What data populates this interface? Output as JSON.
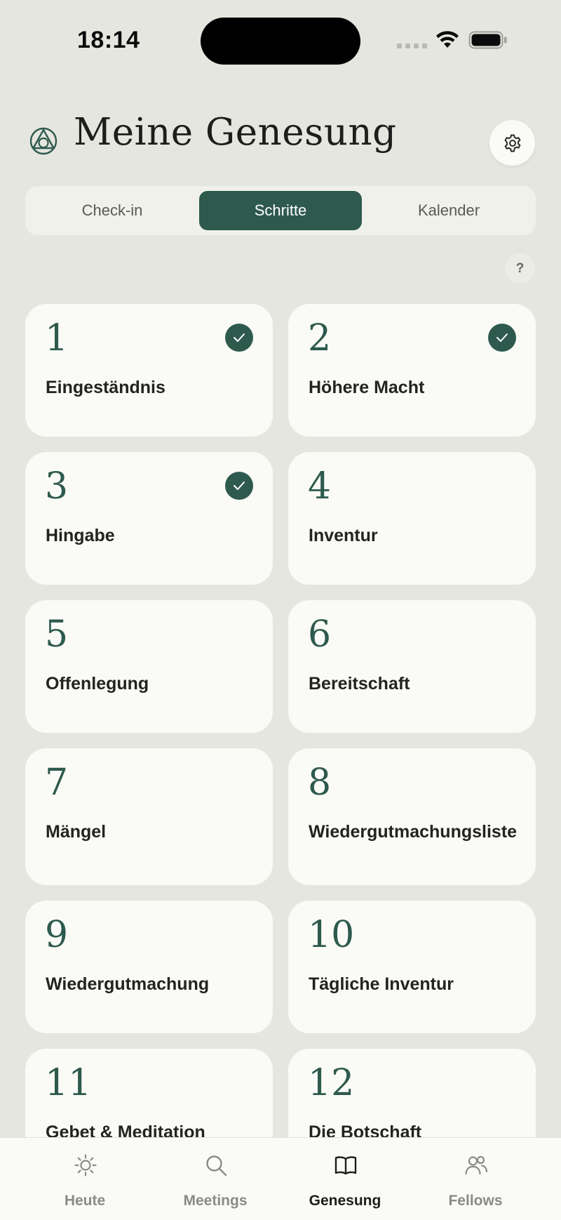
{
  "status_bar": {
    "time": "18:14"
  },
  "header": {
    "title": "Meine Genesung"
  },
  "segments": [
    {
      "label": "Check-in",
      "selected": false
    },
    {
      "label": "Schritte",
      "selected": true
    },
    {
      "label": "Kalender",
      "selected": false
    }
  ],
  "help": {
    "label": "?"
  },
  "steps": [
    {
      "number": "1",
      "label": "Eingeständnis",
      "completed": true
    },
    {
      "number": "2",
      "label": "Höhere Macht",
      "completed": true
    },
    {
      "number": "3",
      "label": "Hingabe",
      "completed": true
    },
    {
      "number": "4",
      "label": "Inventur",
      "completed": false
    },
    {
      "number": "5",
      "label": "Offenlegung",
      "completed": false
    },
    {
      "number": "6",
      "label": "Bereitschaft",
      "completed": false
    },
    {
      "number": "7",
      "label": "Mängel",
      "completed": false
    },
    {
      "number": "8",
      "label": "Wiedergutmachungsliste",
      "completed": false
    },
    {
      "number": "9",
      "label": "Wiedergutmachung",
      "completed": false
    },
    {
      "number": "10",
      "label": "Tägliche Inventur",
      "completed": false
    },
    {
      "number": "11",
      "label": "Gebet & Meditation",
      "completed": false
    },
    {
      "number": "12",
      "label": "Die Botschaft",
      "completed": false
    }
  ],
  "tabbar": {
    "items": [
      {
        "label": "Heute",
        "icon": "sun-icon",
        "active": false
      },
      {
        "label": "Meetings",
        "icon": "search-icon",
        "active": false
      },
      {
        "label": "Genesung",
        "icon": "book-icon",
        "active": true
      },
      {
        "label": "Fellows",
        "icon": "people-icon",
        "active": false
      }
    ]
  },
  "colors": {
    "accent": "#2e5a4e",
    "background": "#e6e6e0",
    "card": "#fafaf6"
  }
}
